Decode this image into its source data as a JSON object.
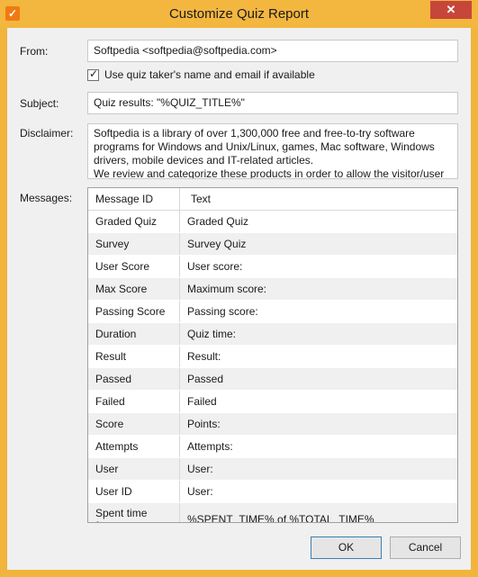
{
  "window": {
    "title": "Customize Quiz Report",
    "close_glyph": "✕",
    "app_icon_glyph": "✓"
  },
  "form": {
    "from_label": "From:",
    "from_value": "Softpedia <softpedia@softpedia.com>",
    "use_quiz_taker_checkbox": {
      "label": "Use quiz taker's name and email if available",
      "checked": true
    },
    "subject_label": "Subject:",
    "subject_value": "Quiz results: \"%QUIZ_TITLE%\"",
    "disclaimer_label": "Disclaimer:",
    "disclaimer_value": "Softpedia is a library of over 1,300,000 free and free-to-try software programs for Windows and Unix/Linux, games, Mac software, Windows drivers, mobile devices and IT-related articles.\nWe review and categorize these products in order to allow the visitor/user",
    "messages_label": "Messages:"
  },
  "messages_table": {
    "columns": [
      "Message ID",
      "Text"
    ],
    "rows": [
      [
        "Graded Quiz",
        "Graded Quiz"
      ],
      [
        "Survey",
        "Survey Quiz"
      ],
      [
        "User Score",
        "User score:"
      ],
      [
        "Max Score",
        "Maximum score:"
      ],
      [
        "Passing Score",
        "Passing score:"
      ],
      [
        "Duration",
        "Quiz time:"
      ],
      [
        "Result",
        "Result:"
      ],
      [
        "Passed",
        "Passed"
      ],
      [
        "Failed",
        "Failed"
      ],
      [
        "Score",
        "Points:"
      ],
      [
        "Attempts",
        "Attempts:"
      ],
      [
        "User",
        "User:"
      ],
      [
        "User ID",
        "User:"
      ],
      [
        "Spent time format",
        "%SPENT_TIME% of %TOTAL_TIME%"
      ]
    ]
  },
  "buttons": {
    "ok": "OK",
    "cancel": "Cancel"
  }
}
